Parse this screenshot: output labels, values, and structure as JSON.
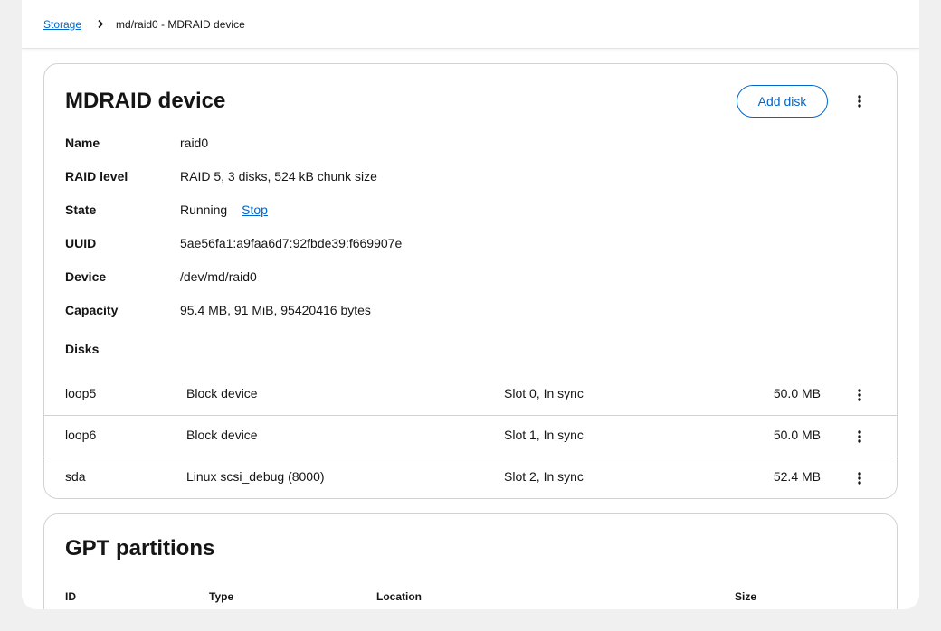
{
  "breadcrumb": {
    "root_label": "Storage",
    "current_label": "md/raid0 - MDRAID device"
  },
  "mdraid_card": {
    "title": "MDRAID device",
    "add_disk_label": "Add disk",
    "details": [
      {
        "term": "Name",
        "value": "raid0"
      },
      {
        "term": "RAID level",
        "value": "RAID 5, 3 disks, 524 kB chunk size"
      },
      {
        "term": "State",
        "value": "Running",
        "action_label": "Stop"
      },
      {
        "term": "UUID",
        "value": "5ae56fa1:a9faa6d7:92fbde39:f669907e"
      },
      {
        "term": "Device",
        "value": "/dev/md/raid0"
      },
      {
        "term": "Capacity",
        "value": "95.4 MB, 91 MiB, 95420416 bytes"
      }
    ],
    "disks_heading": "Disks",
    "disks": [
      {
        "name": "loop5",
        "type": "Block device",
        "slot": "Slot 0, In sync",
        "size": "50.0 MB"
      },
      {
        "name": "loop6",
        "type": "Block device",
        "slot": "Slot 1, In sync",
        "size": "50.0 MB"
      },
      {
        "name": "sda",
        "type": "Linux scsi_debug (8000)",
        "slot": "Slot 2, In sync",
        "size": "52.4 MB"
      }
    ]
  },
  "gpt_card": {
    "title": "GPT partitions",
    "columns": [
      "ID",
      "Type",
      "Location",
      "Size"
    ]
  },
  "icons": {
    "breadcrumb_separator": "chevron-right-icon",
    "kebab": "kebab-menu-icon"
  },
  "colors": {
    "link": "#0066cc",
    "page_background": "#f0f0f0",
    "card_border": "#d2d2d2"
  }
}
